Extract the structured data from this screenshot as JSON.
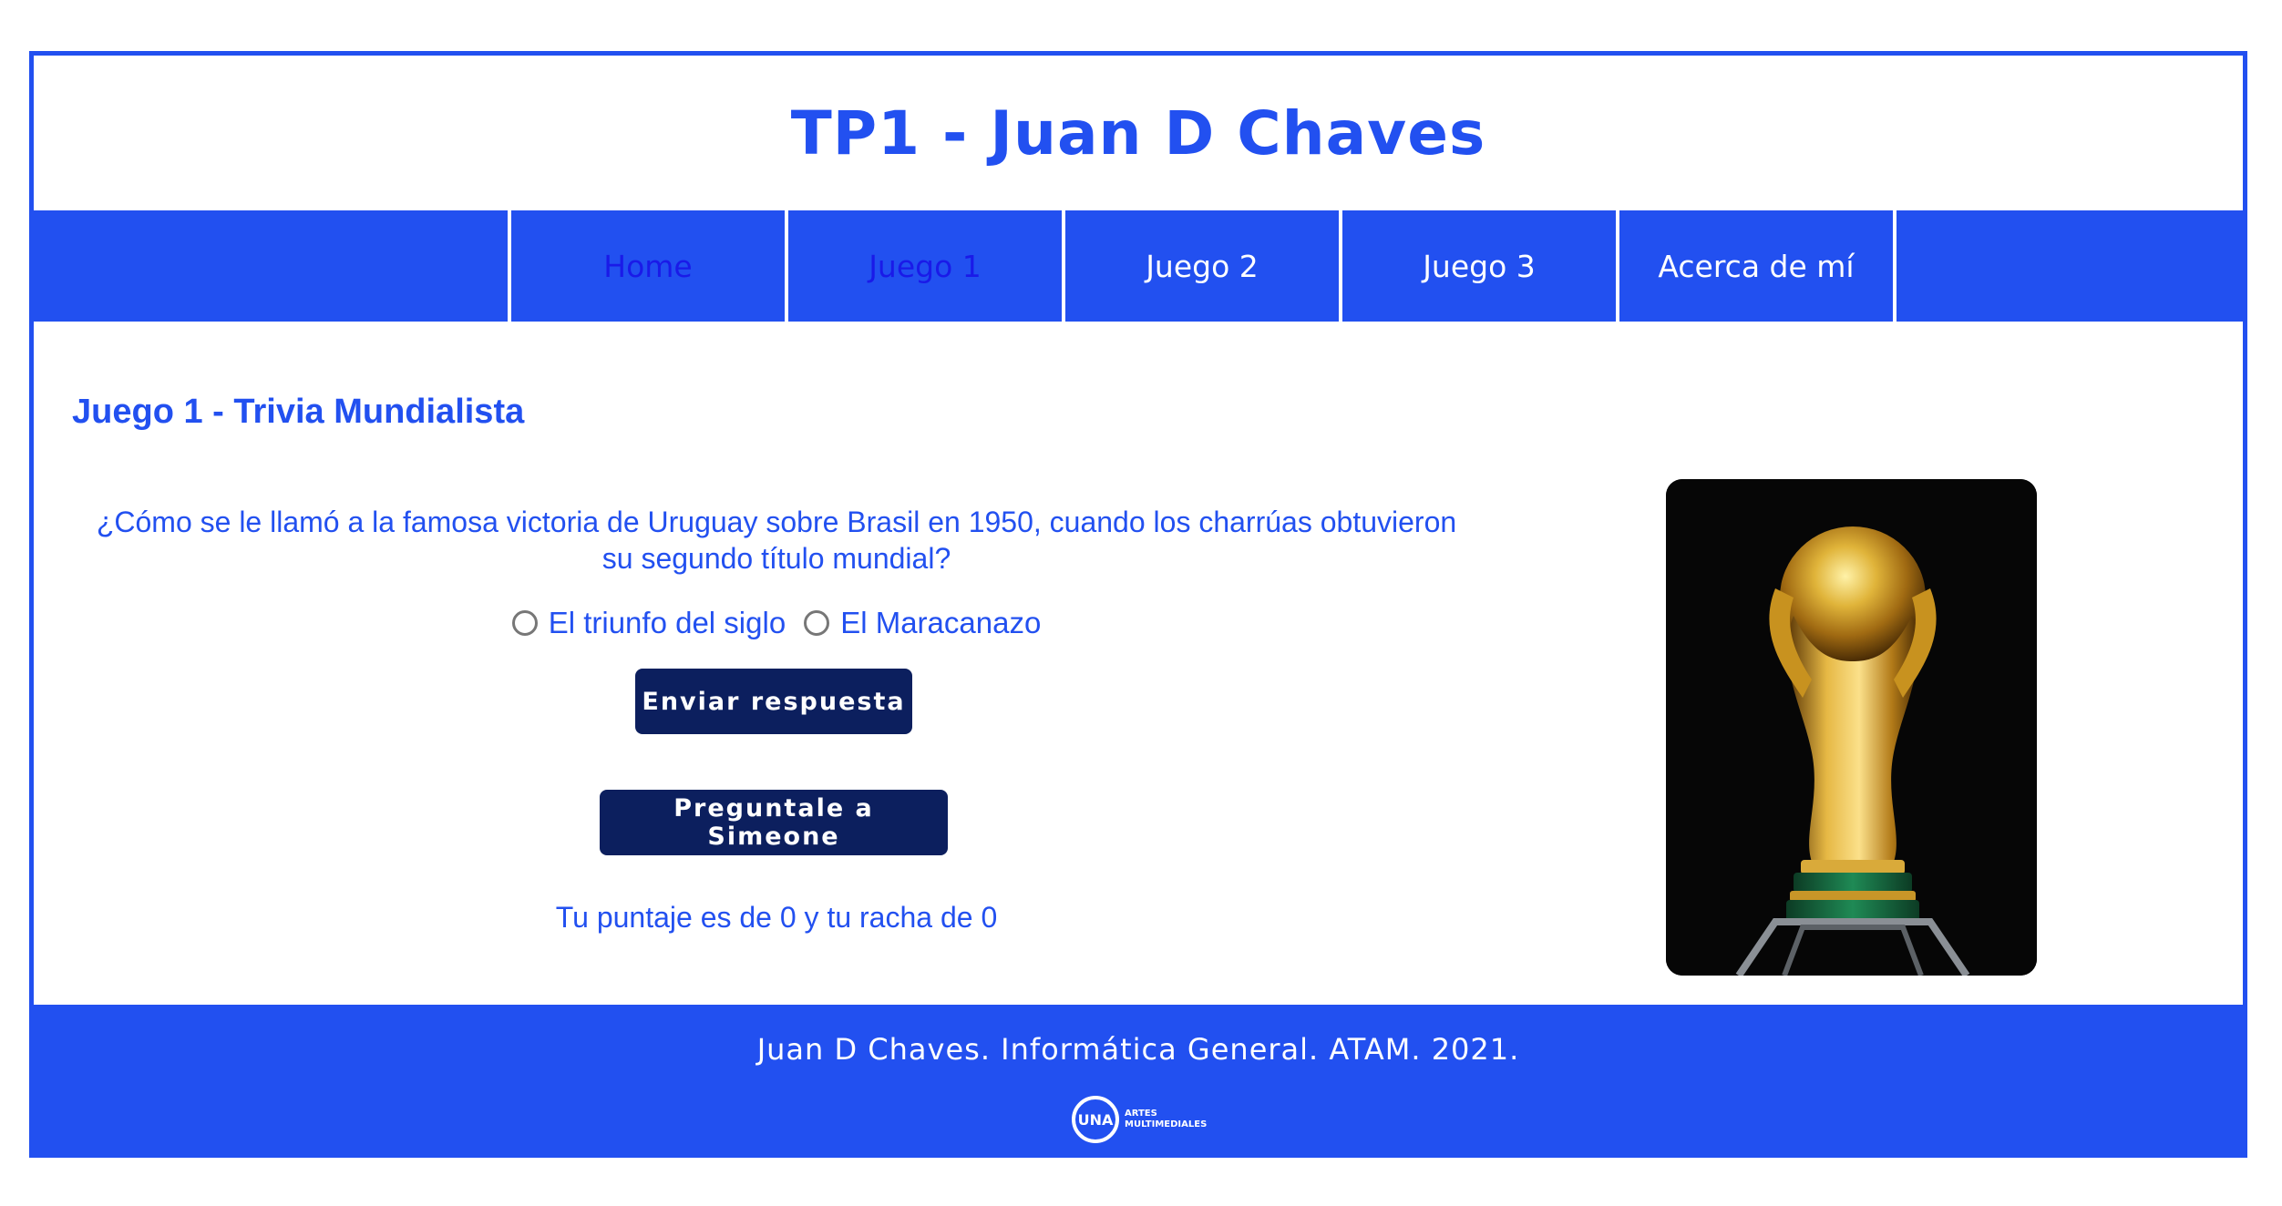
{
  "header": {
    "title": "TP1 - Juan D Chaves"
  },
  "nav": {
    "items": [
      {
        "label": "Home"
      },
      {
        "label": "Juego 1"
      },
      {
        "label": "Juego 2"
      },
      {
        "label": "Juego 3"
      },
      {
        "label": "Acerca de mí"
      }
    ]
  },
  "colors": {
    "primary": "#2250f0",
    "button": "#0c1f5e",
    "visited_link": "#1a1ae8",
    "background": "#ffffff"
  },
  "main": {
    "section_title": "Juego 1 - Trivia Mundialista",
    "question": "¿Cómo se le llamó a la famosa victoria de Uruguay sobre Brasil en 1950, cuando los charrúas obtuvieron su segundo título mundial?",
    "options": [
      {
        "label": "El triunfo del siglo",
        "selected": false
      },
      {
        "label": "El Maracanazo",
        "selected": false
      }
    ],
    "submit_label": "Enviar respuesta",
    "ask_label": "Preguntale a Simeone",
    "score_text": "Tu puntaje es de 0 y tu racha de 0",
    "image_icon": "world-cup-trophy"
  },
  "footer": {
    "text": "Juan D Chaves. Informática General. ATAM. 2021.",
    "logo": {
      "mark": "UNA",
      "line1": "ARTES",
      "line2": "MULTIMEDIALES"
    }
  }
}
